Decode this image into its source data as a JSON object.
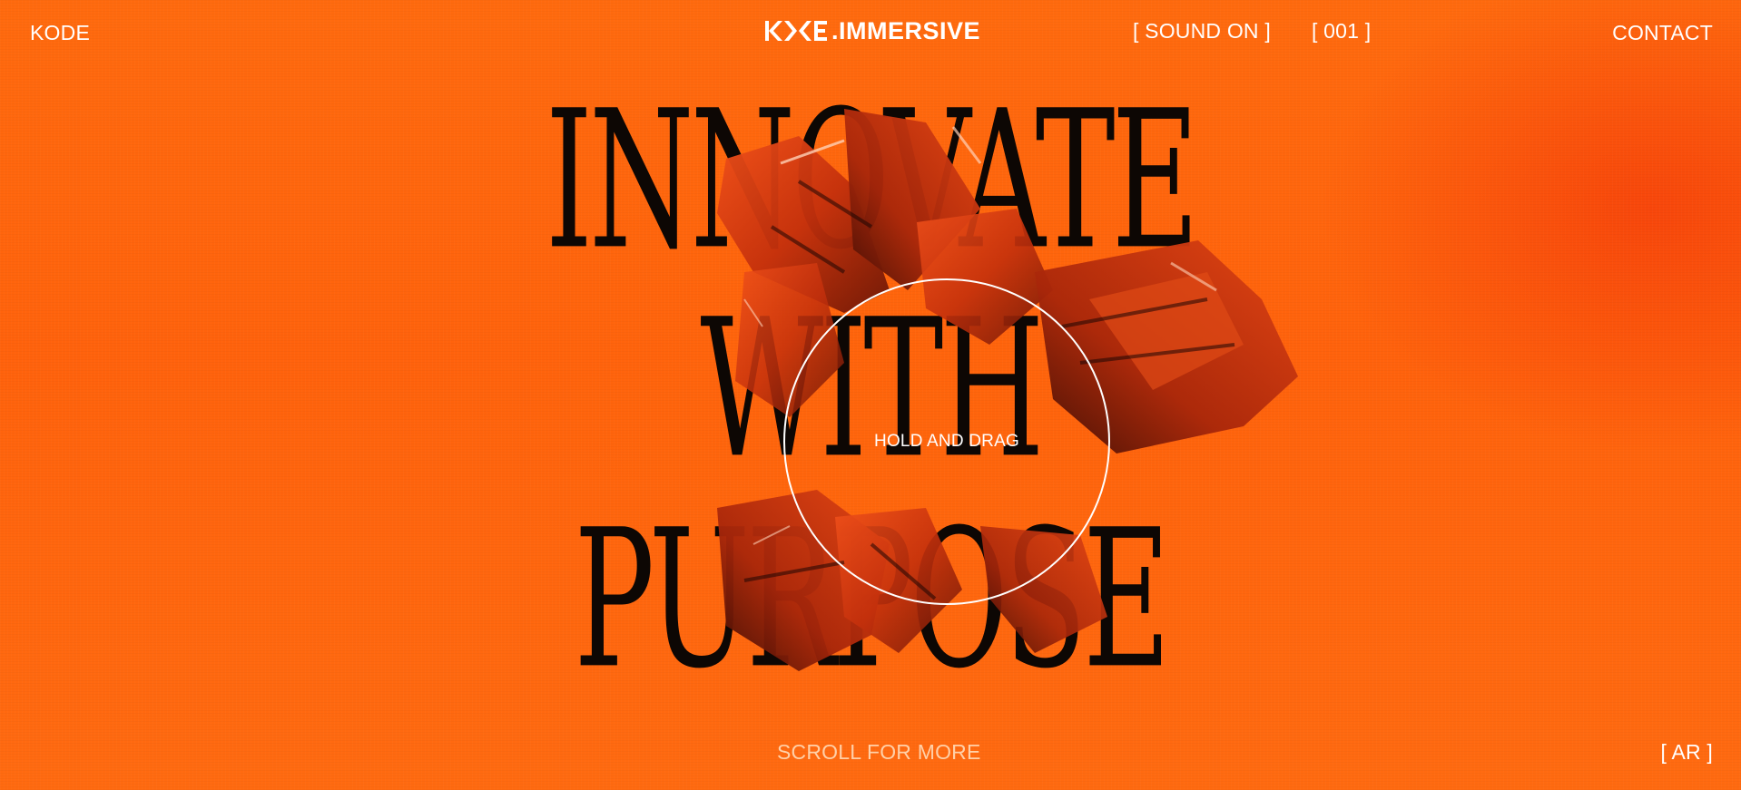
{
  "nav": {
    "brand": "KODE",
    "logo_suffix": ".IMMERSIVE",
    "sound_toggle": "[ SOUND ON ]",
    "counter": "[ 001 ]",
    "contact": "CONTACT"
  },
  "hero": {
    "line_1": "INNOVATE",
    "line_2": "WITH",
    "line_3": "PURPOSE",
    "drag_hint": "HOLD AND DRAG"
  },
  "footer": {
    "scroll_hint": "SCROLL FOR MORE",
    "ar_toggle": "[ AR ]"
  },
  "colors": {
    "background": "#ff6a0e",
    "text": "#ffffff",
    "headline": "#0d0704",
    "scroll_hint": "#ffd0a8"
  }
}
